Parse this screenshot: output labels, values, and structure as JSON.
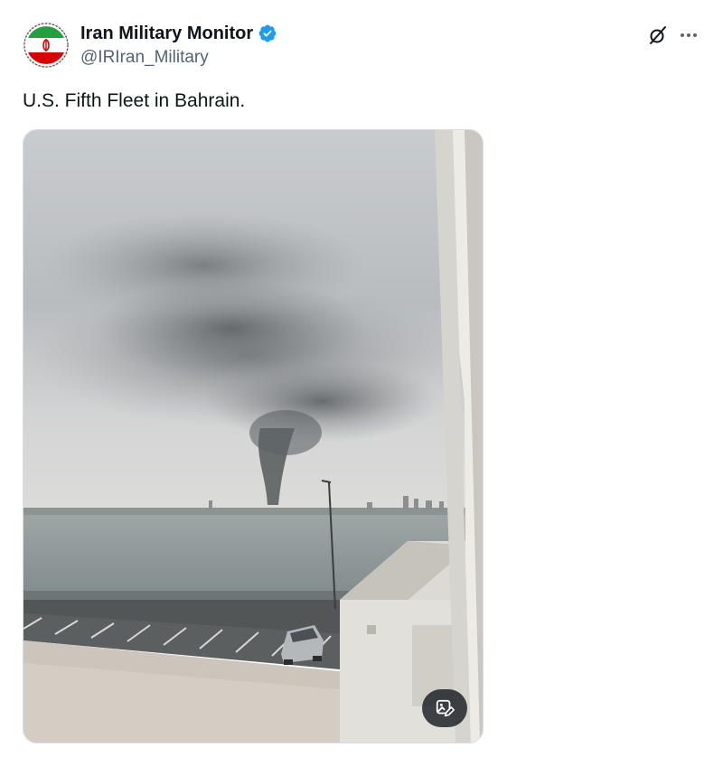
{
  "post": {
    "author": {
      "name": "Iran Military Monitor",
      "handle": "@IRIran_Military",
      "verified": true,
      "verified_color": "#1d9bf0",
      "avatar_icon": "iran-emblem-avatar"
    },
    "text": "U.S. Fifth Fleet in Bahrain.",
    "actions": {
      "grok_icon": "grok-icon",
      "more_icon": "more-icon"
    },
    "media": {
      "type": "photo",
      "overlay_icon": "image-edit-icon"
    }
  }
}
